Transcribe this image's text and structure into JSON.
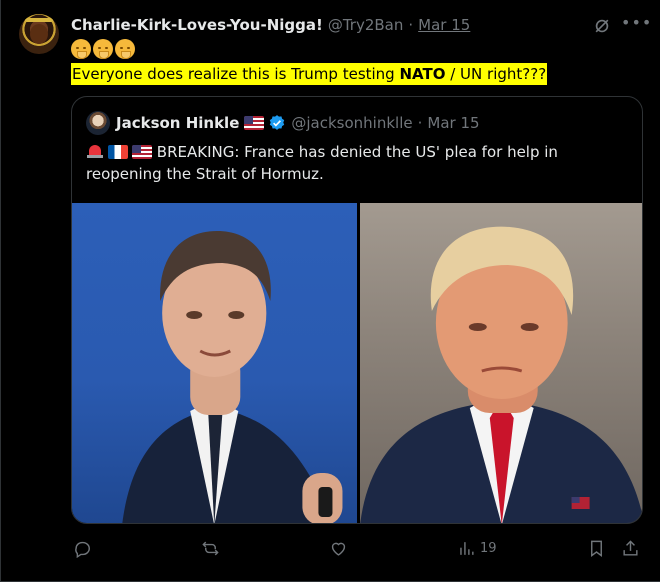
{
  "author": {
    "display_name": "Charlie-Kirk-Loves-You-Nigga!",
    "handle": "@Try2Ban",
    "separator": "·",
    "date": "Mar 15"
  },
  "post": {
    "emoji_count": 3,
    "text_pre": "Everyone does realize this is Trump testing ",
    "text_bold": "NATO",
    "text_post": " / UN right???",
    "highlight_color": "#ffff00"
  },
  "quote": {
    "display_name": "Jackson Hinkle",
    "handle": "@jacksonhinklle",
    "separator": "·",
    "date": "Mar 15",
    "text": "BREAKING: France has denied the US' plea for help in reopening the Strait of Hormuz.",
    "flags": [
      "siren-icon",
      "flag-france",
      "flag-usa"
    ]
  },
  "actions": {
    "views": "19"
  },
  "icons": {
    "more": "more-icon",
    "grok": "grok-icon",
    "verified": "verified-icon",
    "verified_color": "#1d9bf0"
  }
}
